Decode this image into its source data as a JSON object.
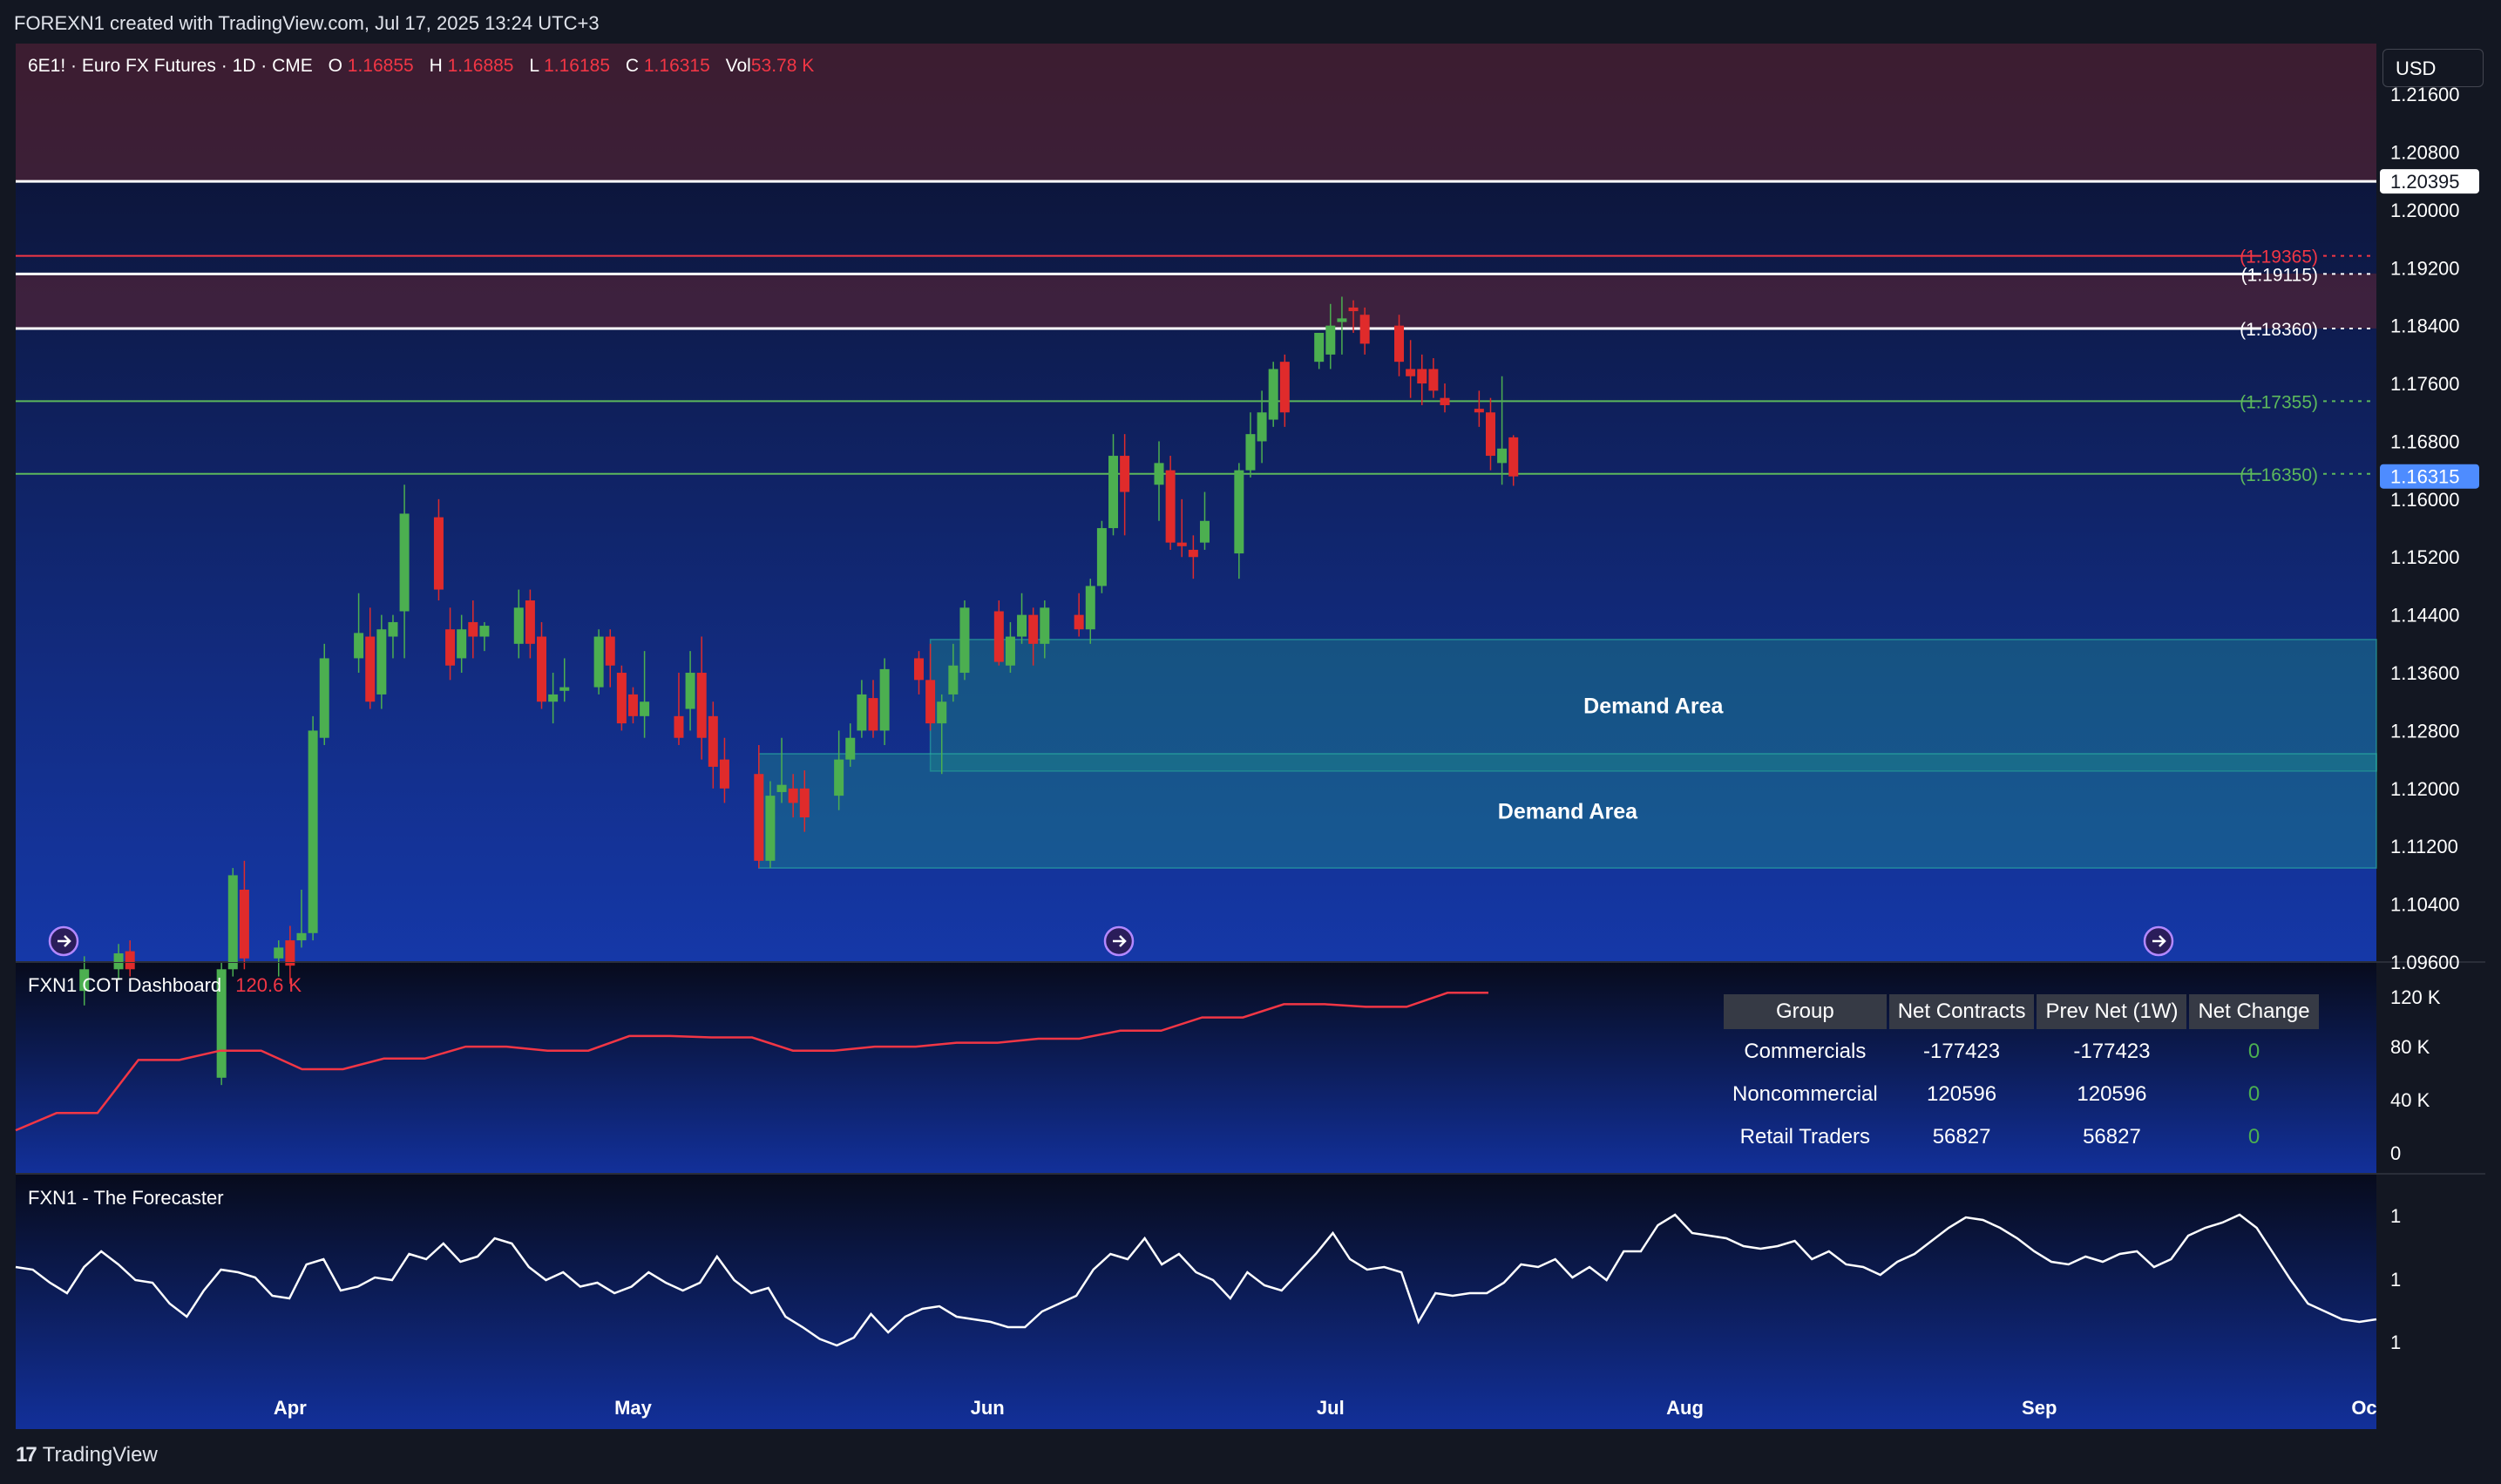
{
  "header": {
    "attribution": "FOREXN1 created with TradingView.com, Jul 17, 2025 13:24 UTC+3"
  },
  "legend": {
    "symbol": "6E1! · Euro FX Futures · 1D · CME",
    "o_label": "O",
    "o_value": "1.16855",
    "h_label": "H",
    "h_value": "1.16885",
    "l_label": "L",
    "l_value": "1.16185",
    "c_label": "C",
    "c_value": "1.16315",
    "vol_label": "Vol",
    "vol_value": "53.78 K"
  },
  "currency": "USD",
  "colors": {
    "background_top": "#0b1029",
    "background_bottom": "#1538a8",
    "up": "#4caf50",
    "down": "#e02b2b",
    "red_line": "#f23645",
    "green_line": "#5cb85c",
    "demand": "#1a7d7d",
    "last_price": "#2962ff"
  },
  "chart_data": [
    {
      "type": "candlestick",
      "symbol": "6E1!",
      "timeframe": "1D",
      "y_axis_ticks": [
        "1.21600",
        "1.20800",
        "1.20000",
        "1.19200",
        "1.18400",
        "1.17600",
        "1.16800",
        "1.16000",
        "1.15200",
        "1.14400",
        "1.13600",
        "1.12800",
        "1.12000",
        "1.11200",
        "1.10400",
        "1.09600"
      ],
      "ylim": [
        1.096,
        1.223
      ],
      "x_axis_ticks": [
        "Apr",
        "May",
        "Jun",
        "Jul",
        "Aug",
        "Sep",
        "Oc"
      ],
      "price_labels": [
        {
          "price": 1.20395,
          "label": "1.20395",
          "style": "white-box"
        },
        {
          "price": 1.16315,
          "label": "1.16315",
          "style": "blue-box"
        }
      ],
      "levels": [
        {
          "price": 1.20395,
          "color": "#ffffff"
        },
        {
          "price": 1.19365,
          "label": "(1.19365)",
          "color": "#f23645"
        },
        {
          "price": 1.19115,
          "label": "(1.19115)",
          "color": "#ffffff"
        },
        {
          "price": 1.1836,
          "label": "(1.18360)",
          "color": "#ffffff"
        },
        {
          "price": 1.17355,
          "label": "(1.17355)",
          "color": "#5cb85c"
        },
        {
          "price": 1.1635,
          "label": "(1.16350)",
          "color": "#5cb85c"
        }
      ],
      "zones": [
        {
          "name": "supply-top",
          "from": 1.204,
          "to": 1.223
        },
        {
          "name": "supply-mid",
          "from": 1.1836,
          "to": 1.1912
        }
      ],
      "demand_areas": [
        {
          "label": "Demand Area",
          "from": 1.1224,
          "to": 1.1406,
          "start": "2025-05-27"
        },
        {
          "label": "Demand Area",
          "from": 1.109,
          "to": 1.1248,
          "start": "2025-05-12"
        }
      ],
      "candles": [
        {
          "date": "2025-03-14",
          "o": 1.092,
          "h": 1.0968,
          "l": 1.09,
          "c": 1.095
        },
        {
          "date": "2025-03-17",
          "o": 1.095,
          "h": 1.0985,
          "l": 1.0935,
          "c": 1.0972
        },
        {
          "date": "2025-03-18",
          "o": 1.0975,
          "h": 1.099,
          "l": 1.094,
          "c": 1.095
        },
        {
          "date": "2025-03-26",
          "o": 1.08,
          "h": 1.096,
          "l": 1.079,
          "c": 1.095
        },
        {
          "date": "2025-03-27",
          "o": 1.095,
          "h": 1.109,
          "l": 1.094,
          "c": 1.108
        },
        {
          "date": "2025-03-28",
          "o": 1.106,
          "h": 1.11,
          "l": 1.095,
          "c": 1.0965
        },
        {
          "date": "2025-03-31",
          "o": 1.0965,
          "h": 1.099,
          "l": 1.094,
          "c": 1.098
        },
        {
          "date": "2025-04-01",
          "o": 1.099,
          "h": 1.101,
          "l": 1.093,
          "c": 1.0955
        },
        {
          "date": "2025-04-02",
          "o": 1.099,
          "h": 1.106,
          "l": 1.098,
          "c": 1.1
        },
        {
          "date": "2025-04-03",
          "o": 1.1,
          "h": 1.13,
          "l": 1.099,
          "c": 1.128
        },
        {
          "date": "2025-04-04",
          "o": 1.127,
          "h": 1.14,
          "l": 1.126,
          "c": 1.138
        },
        {
          "date": "2025-04-07",
          "o": 1.138,
          "h": 1.147,
          "l": 1.136,
          "c": 1.1415
        },
        {
          "date": "2025-04-08",
          "o": 1.141,
          "h": 1.145,
          "l": 1.131,
          "c": 1.132
        },
        {
          "date": "2025-04-09",
          "o": 1.133,
          "h": 1.144,
          "l": 1.131,
          "c": 1.142
        },
        {
          "date": "2025-04-10",
          "o": 1.141,
          "h": 1.144,
          "l": 1.138,
          "c": 1.143
        },
        {
          "date": "2025-04-11",
          "o": 1.1445,
          "h": 1.162,
          "l": 1.138,
          "c": 1.158
        },
        {
          "date": "2025-04-14",
          "o": 1.1575,
          "h": 1.16,
          "l": 1.146,
          "c": 1.1475
        },
        {
          "date": "2025-04-15",
          "o": 1.142,
          "h": 1.145,
          "l": 1.135,
          "c": 1.137
        },
        {
          "date": "2025-04-16",
          "o": 1.138,
          "h": 1.144,
          "l": 1.136,
          "c": 1.142
        },
        {
          "date": "2025-04-17",
          "o": 1.143,
          "h": 1.146,
          "l": 1.138,
          "c": 1.141
        },
        {
          "date": "2025-04-18",
          "o": 1.141,
          "h": 1.143,
          "l": 1.139,
          "c": 1.1425
        },
        {
          "date": "2025-04-21",
          "o": 1.14,
          "h": 1.1475,
          "l": 1.138,
          "c": 1.145
        },
        {
          "date": "2025-04-22",
          "o": 1.146,
          "h": 1.1475,
          "l": 1.138,
          "c": 1.14
        },
        {
          "date": "2025-04-23",
          "o": 1.141,
          "h": 1.143,
          "l": 1.131,
          "c": 1.132
        },
        {
          "date": "2025-04-24",
          "o": 1.132,
          "h": 1.136,
          "l": 1.129,
          "c": 1.133
        },
        {
          "date": "2025-04-25",
          "o": 1.1335,
          "h": 1.138,
          "l": 1.132,
          "c": 1.134
        },
        {
          "date": "2025-04-28",
          "o": 1.134,
          "h": 1.142,
          "l": 1.133,
          "c": 1.141
        },
        {
          "date": "2025-04-29",
          "o": 1.141,
          "h": 1.142,
          "l": 1.134,
          "c": 1.137
        },
        {
          "date": "2025-04-30",
          "o": 1.136,
          "h": 1.137,
          "l": 1.128,
          "c": 1.129
        },
        {
          "date": "2025-05-01",
          "o": 1.133,
          "h": 1.134,
          "l": 1.129,
          "c": 1.13
        },
        {
          "date": "2025-05-02",
          "o": 1.13,
          "h": 1.139,
          "l": 1.127,
          "c": 1.132
        },
        {
          "date": "2025-05-05",
          "o": 1.13,
          "h": 1.136,
          "l": 1.126,
          "c": 1.127
        },
        {
          "date": "2025-05-06",
          "o": 1.131,
          "h": 1.139,
          "l": 1.128,
          "c": 1.136
        },
        {
          "date": "2025-05-07",
          "o": 1.136,
          "h": 1.141,
          "l": 1.124,
          "c": 1.127
        },
        {
          "date": "2025-05-08",
          "o": 1.13,
          "h": 1.132,
          "l": 1.12,
          "c": 1.123
        },
        {
          "date": "2025-05-09",
          "o": 1.124,
          "h": 1.127,
          "l": 1.118,
          "c": 1.12
        },
        {
          "date": "2025-05-12",
          "o": 1.122,
          "h": 1.126,
          "l": 1.109,
          "c": 1.11
        },
        {
          "date": "2025-05-13",
          "o": 1.11,
          "h": 1.121,
          "l": 1.109,
          "c": 1.119
        },
        {
          "date": "2025-05-14",
          "o": 1.1195,
          "h": 1.127,
          "l": 1.118,
          "c": 1.1205
        },
        {
          "date": "2025-05-15",
          "o": 1.12,
          "h": 1.122,
          "l": 1.116,
          "c": 1.118
        },
        {
          "date": "2025-05-16",
          "o": 1.12,
          "h": 1.1225,
          "l": 1.114,
          "c": 1.116
        },
        {
          "date": "2025-05-19",
          "o": 1.119,
          "h": 1.128,
          "l": 1.117,
          "c": 1.124
        },
        {
          "date": "2025-05-20",
          "o": 1.124,
          "h": 1.129,
          "l": 1.123,
          "c": 1.127
        },
        {
          "date": "2025-05-21",
          "o": 1.128,
          "h": 1.135,
          "l": 1.127,
          "c": 1.133
        },
        {
          "date": "2025-05-22",
          "o": 1.1325,
          "h": 1.135,
          "l": 1.127,
          "c": 1.128
        },
        {
          "date": "2025-05-23",
          "o": 1.128,
          "h": 1.138,
          "l": 1.126,
          "c": 1.1365
        },
        {
          "date": "2025-05-26",
          "o": 1.138,
          "h": 1.139,
          "l": 1.133,
          "c": 1.135
        },
        {
          "date": "2025-05-27",
          "o": 1.135,
          "h": 1.14,
          "l": 1.128,
          "c": 1.129
        },
        {
          "date": "2025-05-28",
          "o": 1.129,
          "h": 1.133,
          "l": 1.122,
          "c": 1.132
        },
        {
          "date": "2025-05-29",
          "o": 1.133,
          "h": 1.14,
          "l": 1.132,
          "c": 1.137
        },
        {
          "date": "2025-05-30",
          "o": 1.136,
          "h": 1.146,
          "l": 1.135,
          "c": 1.145
        },
        {
          "date": "2025-06-02",
          "o": 1.1445,
          "h": 1.146,
          "l": 1.137,
          "c": 1.1375
        },
        {
          "date": "2025-06-03",
          "o": 1.137,
          "h": 1.143,
          "l": 1.136,
          "c": 1.141
        },
        {
          "date": "2025-06-04",
          "o": 1.141,
          "h": 1.147,
          "l": 1.14,
          "c": 1.144
        },
        {
          "date": "2025-06-05",
          "o": 1.144,
          "h": 1.145,
          "l": 1.137,
          "c": 1.14
        },
        {
          "date": "2025-06-06",
          "o": 1.14,
          "h": 1.146,
          "l": 1.138,
          "c": 1.145
        },
        {
          "date": "2025-06-09",
          "o": 1.144,
          "h": 1.147,
          "l": 1.141,
          "c": 1.142
        },
        {
          "date": "2025-06-10",
          "o": 1.142,
          "h": 1.149,
          "l": 1.14,
          "c": 1.148
        },
        {
          "date": "2025-06-11",
          "o": 1.148,
          "h": 1.157,
          "l": 1.147,
          "c": 1.156
        },
        {
          "date": "2025-06-12",
          "o": 1.156,
          "h": 1.169,
          "l": 1.155,
          "c": 1.166
        },
        {
          "date": "2025-06-13",
          "o": 1.166,
          "h": 1.169,
          "l": 1.155,
          "c": 1.161
        },
        {
          "date": "2025-06-16",
          "o": 1.162,
          "h": 1.168,
          "l": 1.157,
          "c": 1.165
        },
        {
          "date": "2025-06-17",
          "o": 1.164,
          "h": 1.166,
          "l": 1.153,
          "c": 1.154
        },
        {
          "date": "2025-06-18",
          "o": 1.154,
          "h": 1.16,
          "l": 1.152,
          "c": 1.1535
        },
        {
          "date": "2025-06-19",
          "o": 1.153,
          "h": 1.155,
          "l": 1.149,
          "c": 1.152
        },
        {
          "date": "2025-06-20",
          "o": 1.154,
          "h": 1.161,
          "l": 1.153,
          "c": 1.157
        },
        {
          "date": "2025-06-23",
          "o": 1.1525,
          "h": 1.165,
          "l": 1.149,
          "c": 1.164
        },
        {
          "date": "2025-06-24",
          "o": 1.164,
          "h": 1.172,
          "l": 1.163,
          "c": 1.169
        },
        {
          "date": "2025-06-25",
          "o": 1.168,
          "h": 1.175,
          "l": 1.165,
          "c": 1.172
        },
        {
          "date": "2025-06-26",
          "o": 1.171,
          "h": 1.179,
          "l": 1.17,
          "c": 1.178
        },
        {
          "date": "2025-06-27",
          "o": 1.179,
          "h": 1.18,
          "l": 1.17,
          "c": 1.172
        },
        {
          "date": "2025-06-30",
          "o": 1.179,
          "h": 1.183,
          "l": 1.178,
          "c": 1.183
        },
        {
          "date": "2025-07-01",
          "o": 1.18,
          "h": 1.187,
          "l": 1.178,
          "c": 1.184
        },
        {
          "date": "2025-07-02",
          "o": 1.1845,
          "h": 1.188,
          "l": 1.18,
          "c": 1.185
        },
        {
          "date": "2025-07-03",
          "o": 1.1865,
          "h": 1.1875,
          "l": 1.183,
          "c": 1.186
        },
        {
          "date": "2025-07-04",
          "o": 1.1855,
          "h": 1.1865,
          "l": 1.18,
          "c": 1.1815
        },
        {
          "date": "2025-07-07",
          "o": 1.184,
          "h": 1.1855,
          "l": 1.177,
          "c": 1.179
        },
        {
          "date": "2025-07-08",
          "o": 1.178,
          "h": 1.182,
          "l": 1.174,
          "c": 1.177
        },
        {
          "date": "2025-07-09",
          "o": 1.178,
          "h": 1.18,
          "l": 1.173,
          "c": 1.176
        },
        {
          "date": "2025-07-10",
          "o": 1.178,
          "h": 1.1795,
          "l": 1.174,
          "c": 1.175
        },
        {
          "date": "2025-07-11",
          "o": 1.174,
          "h": 1.176,
          "l": 1.172,
          "c": 1.173
        },
        {
          "date": "2025-07-14",
          "o": 1.1725,
          "h": 1.175,
          "l": 1.17,
          "c": 1.172
        },
        {
          "date": "2025-07-15",
          "o": 1.172,
          "h": 1.174,
          "l": 1.164,
          "c": 1.166
        },
        {
          "date": "2025-07-16",
          "o": 1.165,
          "h": 1.177,
          "l": 1.162,
          "c": 1.167
        },
        {
          "date": "2025-07-17",
          "o": 1.16855,
          "h": 1.16885,
          "l": 1.16185,
          "c": 1.16315
        }
      ]
    },
    {
      "type": "line",
      "name": "FXN1 COT Dashboard",
      "last_value": "120.6 K",
      "y_axis_ticks": [
        "120 K",
        "80 K",
        "40 K",
        "0"
      ],
      "ylim": [
        0,
        128000
      ],
      "x": [
        "2025-03-07",
        "2025-03-14",
        "2025-03-21",
        "2025-03-28",
        "2025-04-04",
        "2025-04-11",
        "2025-04-18",
        "2025-04-25",
        "2025-05-02",
        "2025-05-09",
        "2025-05-16",
        "2025-05-23",
        "2025-05-30",
        "2025-06-06",
        "2025-06-13",
        "2025-06-20",
        "2025-06-27",
        "2025-07-04",
        "2025-07-11",
        "2025-07-17"
      ],
      "values": [
        17000,
        30000,
        30000,
        70000,
        70000,
        77000,
        77000,
        63000,
        63000,
        71000,
        71000,
        80000,
        80000,
        77000,
        77000,
        88000,
        88000,
        87000,
        87000,
        77000,
        77000,
        80000,
        80000,
        83000,
        83000,
        86000,
        86000,
        92000,
        92000,
        102000,
        102000,
        112000,
        112000,
        110000,
        110000,
        120600,
        120600
      ]
    },
    {
      "type": "line",
      "name": "FXN1 - The Forecaster",
      "y_axis_ticks": [
        "1",
        "1",
        "1"
      ],
      "values": [
        0.6,
        0.58,
        0.48,
        0.4,
        0.6,
        0.72,
        0.62,
        0.5,
        0.48,
        0.32,
        0.22,
        0.42,
        0.58,
        0.56,
        0.52,
        0.38,
        0.36,
        0.62,
        0.66,
        0.42,
        0.45,
        0.52,
        0.5,
        0.7,
        0.66,
        0.78,
        0.64,
        0.68,
        0.82,
        0.78,
        0.6,
        0.5,
        0.56,
        0.45,
        0.48,
        0.4,
        0.45,
        0.56,
        0.48,
        0.42,
        0.48,
        0.68,
        0.5,
        0.4,
        0.44,
        0.22,
        0.14,
        0.05,
        0.0,
        0.06,
        0.24,
        0.1,
        0.22,
        0.28,
        0.3,
        0.22,
        0.2,
        0.18,
        0.14,
        0.14,
        0.26,
        0.32,
        0.38,
        0.58,
        0.7,
        0.66,
        0.82,
        0.62,
        0.7,
        0.56,
        0.5,
        0.36,
        0.56,
        0.46,
        0.42,
        0.56,
        0.7,
        0.86,
        0.66,
        0.58,
        0.6,
        0.56,
        0.18,
        0.4,
        0.38,
        0.4,
        0.4,
        0.48,
        0.62,
        0.6,
        0.66,
        0.52,
        0.6,
        0.5,
        0.72,
        0.72,
        0.92,
        1.0,
        0.86,
        0.84,
        0.82,
        0.76,
        0.74,
        0.76,
        0.8,
        0.66,
        0.72,
        0.62,
        0.6,
        0.54,
        0.64,
        0.7,
        0.8,
        0.9,
        0.98,
        0.96,
        0.9,
        0.82,
        0.72,
        0.64,
        0.62,
        0.68,
        0.64,
        0.7,
        0.72,
        0.6,
        0.66,
        0.84,
        0.9,
        0.94,
        1.0,
        0.9,
        0.7,
        0.5,
        0.32,
        0.26,
        0.2,
        0.18,
        0.2
      ]
    }
  ],
  "demand_label_1": "Demand Area",
  "demand_label_2": "Demand Area",
  "cot_table": {
    "headers": [
      "Group",
      "Net Contracts",
      "Prev Net (1W)",
      "Net Change"
    ],
    "rows": [
      [
        "Commercials",
        "-177423",
        "-177423",
        "0"
      ],
      [
        "Noncommercial",
        "120596",
        "120596",
        "0"
      ],
      [
        "Retail Traders",
        "56827",
        "56827",
        "0"
      ]
    ]
  },
  "cot_title": "FXN1 COT Dashboard",
  "cot_value": "120.6 K",
  "forecaster_title": "FXN1 - The Forecaster",
  "footer": {
    "brand": "TradingView"
  }
}
